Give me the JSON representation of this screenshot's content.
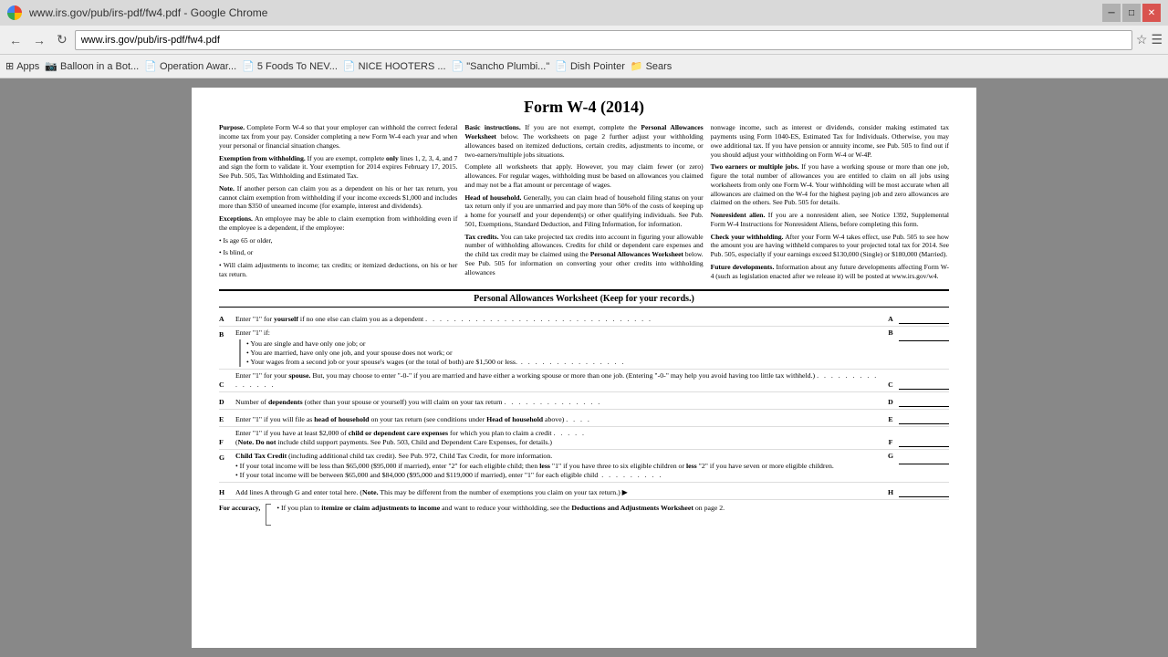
{
  "browser": {
    "title": "www.irs.gov/pub/irs-pdf/fw4.pdf - Google Chrome",
    "address": "www.irs.gov/pub/irs-pdf/fw4.pdf",
    "bookmarks": [
      {
        "label": "Apps",
        "icon": "⊞"
      },
      {
        "label": "Balloon in a Bot...",
        "icon": "📷"
      },
      {
        "label": "Operation Awar...",
        "icon": "📄"
      },
      {
        "label": "5 Foods To NEV...",
        "icon": "📄"
      },
      {
        "label": "NICE HOOTERS ...",
        "icon": "📄"
      },
      {
        "label": "\"Sancho Plumbi...\"",
        "icon": "📄"
      },
      {
        "label": "Dish Pointer",
        "icon": "📄"
      },
      {
        "label": "Sears",
        "icon": "📁"
      }
    ]
  },
  "pdf": {
    "form_title": "Form W-4 (2014)",
    "col1": {
      "purpose_heading": "Purpose.",
      "purpose_text": "Complete Form W-4 so that your employer can withhold the correct federal income tax from your pay. Consider completing a new Form W-4 each year and when your personal or financial situation changes.",
      "exemption_heading": "Exemption from withholding.",
      "exemption_text": "If you are exempt, complete only lines 1, 2, 3, 4, and 7 and sign the form to validate it. Your exemption for 2014 expires February 17, 2015. See Pub. 505, Tax Withholding and Estimated Tax.",
      "note_heading": "Note.",
      "note_text": "If another person can claim you as a dependent on his or her tax return, you cannot claim exemption from withholding if your income exceeds $1,000 and includes more than $350 of unearned income (for example, interest and dividends).",
      "exceptions_heading": "Exceptions.",
      "exceptions_text": "An employee may be able to claim exemption from withholding even if the employee is a dependent, if the employee:",
      "bullets": [
        "Is age 65 or older,",
        "Is blind, or",
        "Will claim adjustments to income; tax credits; or itemized deductions, on his or her tax return."
      ]
    },
    "col2": {
      "basic_heading": "Basic instructions.",
      "basic_text": "If you are not exempt, complete the Personal Allowances Worksheet below. The worksheets on page 2 further adjust your withholding allowances based on itemized deductions, certain credits, adjustments to income, or two-earners/multiple jobs situations.",
      "complete_text": "Complete all worksheets that apply. However, you may claim fewer (or zero) allowances. For regular wages, withholding must be based on allowances you claimed and may not be a flat amount or percentage of wages.",
      "head_heading": "Head of household.",
      "head_text": "Generally, you can claim head of household filing status on your tax return only if you are unmarried and pay more than 50% of the costs of keeping up a home for yourself and your dependent(s) or other qualifying individuals. See Pub. 501, Exemptions, Standard Deduction, and Filing Information, for information.",
      "tax_heading": "Tax credits.",
      "tax_text": "You can take projected tax credits into account in figuring your allowable number of withholding allowances. Credits for child or dependent care expenses and the child tax credit may be claimed using the Personal Allowances Worksheet below. See Pub. 505 for information on converting your other credits into withholding allowances"
    },
    "col3": {
      "nonwage_text": "nonwage income, such as interest or dividends, consider making estimated tax payments using Form 1040-ES, Estimated Tax for Individuals. Otherwise, you may owe additional tax. If you have pension or annuity income, see Pub. 505 to find out if you should adjust your withholding on Form W-4 or W-4P.",
      "two_earners_heading": "Two earners or multiple jobs.",
      "two_earners_text": "If you have a working spouse or more than one job, figure the total number of allowances you are entitled to claim on all jobs using worksheets from only one Form W-4. Your withholding will be most accurate when all allowances are claimed on the W-4 for the highest paying job and zero allowances are claimed on the others. See Pub. 505 for details.",
      "nonresident_heading": "Nonresident alien.",
      "nonresident_text": "If you are a nonresident alien, see Notice 1392, Supplemental Form W-4 Instructions for Nonresident Aliens, before completing this form.",
      "check_heading": "Check your withholding.",
      "check_text": "After your Form W-4 takes effect, use Pub. 505 to see how the amount you are having withheld compares to your projected total tax for 2014. See Pub. 505, especially if your earnings exceed $130,000 (Single) or $180,000 (Married).",
      "future_heading": "Future developments.",
      "future_text": "Information about any future developments affecting Form W-4 (such as legislation enacted after we release it) will be posted at www.irs.gov/w4."
    },
    "worksheet": {
      "title": "Personal Allowances Worksheet",
      "subtitle": "(Keep for your records.)",
      "rows": [
        {
          "letter": "A",
          "content": "Enter \"1\" for yourself if no one else can claim you as a dependent",
          "dots": true,
          "end_letter": "A"
        },
        {
          "letter": "B",
          "label": "Enter \"1\" if:",
          "sub_items": [
            "You are single and have only one job; or",
            "You are married, have only one job, and your spouse does not work; or",
            "Your wages from a second job or your spouse's wages (or the total of both) are $1,500 or less."
          ],
          "dots": true,
          "end_letter": "B"
        },
        {
          "letter": "C",
          "content": "Enter \"1\" for your spouse. But, you may choose to enter \"-0-\" if you are married and have either a working spouse or more than one job. (Entering \"-0-\" may help you avoid having too little tax withheld.)",
          "dots": true,
          "end_letter": "C"
        },
        {
          "letter": "D",
          "content": "Number of dependents (other than your spouse or yourself) you will claim on your tax return",
          "dots": true,
          "end_letter": "D"
        },
        {
          "letter": "E",
          "content": "Enter \"1\" if you will file as head of household on your tax return (see conditions under Head of household above)",
          "dots": true,
          "end_letter": "E"
        },
        {
          "letter": "F",
          "content": "Enter \"1\" if you have at least $2,000 of child or dependent care expenses for which you plan to claim a credit (Note. Do not include child support payments. See Pub. 503, Child and Dependent Care Expenses, for details.)",
          "dots": true,
          "end_letter": "F"
        },
        {
          "letter": "G",
          "content_parts": [
            "Child Tax Credit (including additional child tax credit). See Pub. 972, Child Tax Credit, for more information.",
            "• If your total income will be less than $65,000 ($95,000 if married), enter \"2\" for each eligible child; then less \"1\" if you have three to six eligible children or less \"2\" if you have seven or more eligible children.",
            "• If your total income will be between $65,000 and $84,000 ($95,000 and $119,000 if married), enter \"1\" for each eligible child"
          ],
          "dots": true,
          "end_letter": "G"
        },
        {
          "letter": "H",
          "content": "Add lines A through G and enter total here. (Note. This may be different from the number of exemptions you claim on your tax return.)",
          "arrow": "▶",
          "end_letter": "H"
        }
      ],
      "for_accuracy_label": "For accuracy,",
      "for_accuracy_bracket_text": "• If you plan to itemize or claim adjustments to income and want to reduce your withholding, see the Deductions and Adjustments Worksheet on page 2."
    }
  }
}
